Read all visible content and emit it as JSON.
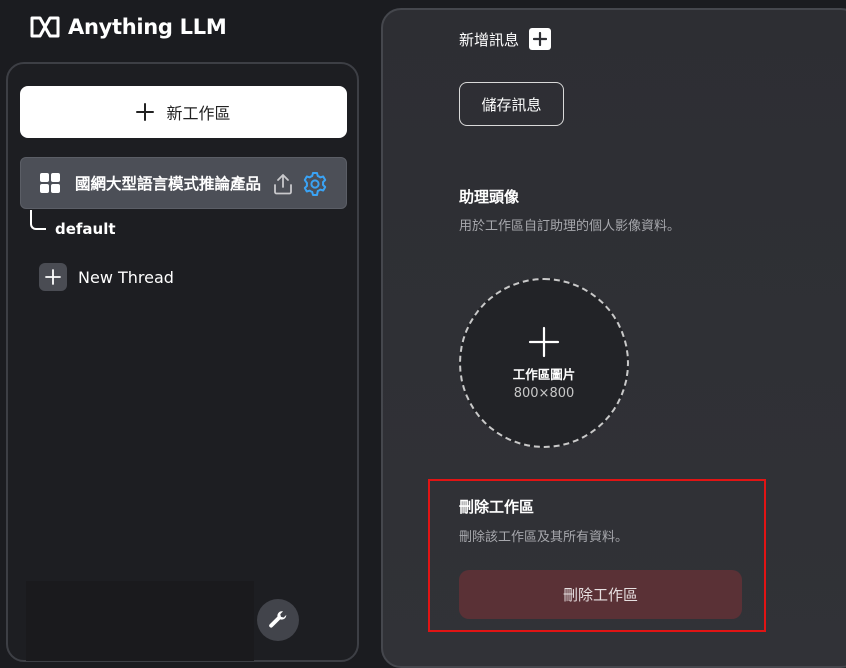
{
  "brand": {
    "logo_icon": "anything-llm-logo-icon",
    "name": "Anything LLM"
  },
  "sidebar": {
    "new_workspace_label": "新工作區",
    "workspace": {
      "name": "國網大型語言模式推論產品",
      "icon": "grid-icon",
      "actions": [
        "upload-icon",
        "gear-icon"
      ],
      "gear_color": "#3aa3f5"
    },
    "threads": [
      {
        "label": "default"
      }
    ],
    "new_thread_label": "New Thread",
    "footer_icon": "wrench-icon"
  },
  "main": {
    "add_message_label": "新增訊息",
    "save_messages_label": "儲存訊息",
    "assistant_avatar": {
      "title": "助理頭像",
      "description": "用於工作區自訂助理的個人影像資料。",
      "upload_title": "工作區圖片",
      "upload_size": "800×800"
    },
    "delete_workspace": {
      "title": "刪除工作區",
      "description": "刪除該工作區及其所有資料。",
      "button_label": "刪除工作區",
      "highlight_color": "#e11414",
      "button_color": "#5a3136"
    }
  }
}
